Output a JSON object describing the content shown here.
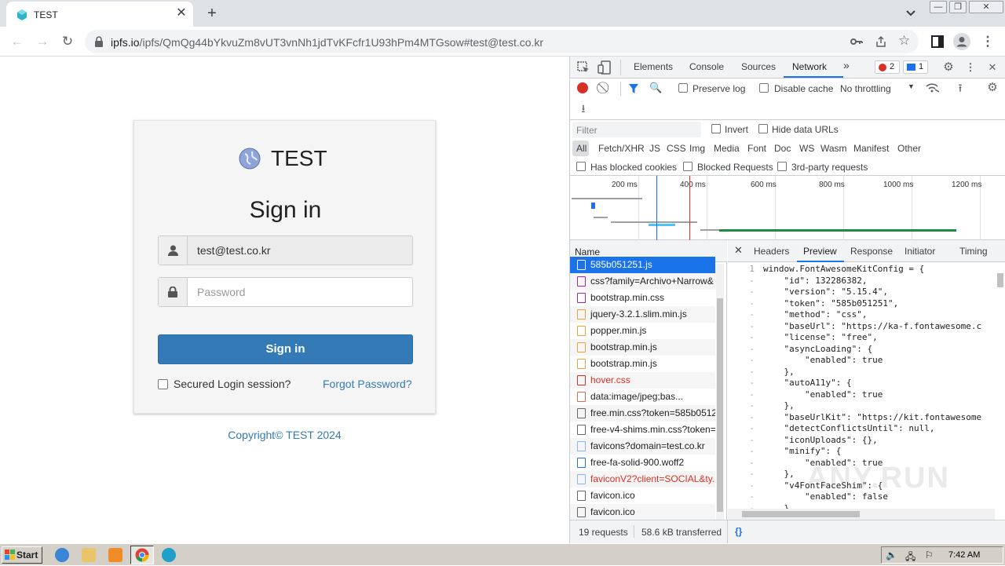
{
  "browser": {
    "tab_title": "TEST",
    "url_host": "ipfs.io",
    "url_rest": "/ipfs/QmQg44bYkvuZm8vUT3vnNh1jdTvKFcfr1U93hPm4MTGsow#test@test.co.kr"
  },
  "page": {
    "brand": "TEST",
    "heading": "Sign in",
    "email_value": "test@test.co.kr",
    "password_placeholder": "Password",
    "signin_label": "Sign in",
    "remember_label": "Secured Login session?",
    "forgot_label": "Forgot Password?",
    "copyright": "Copyright© TEST 2024"
  },
  "devtools": {
    "tabs": [
      "Elements",
      "Console",
      "Sources",
      "Network"
    ],
    "more": "»",
    "error_count": "2",
    "message_count": "1",
    "toolbar": {
      "preserve_log": "Preserve log",
      "disable_cache": "Disable cache",
      "throttling": "No throttling"
    },
    "filter_placeholder": "Filter",
    "invert": "Invert",
    "hide_data_urls": "Hide data URLs",
    "types": [
      "All",
      "Fetch/XHR",
      "JS",
      "CSS",
      "Img",
      "Media",
      "Font",
      "Doc",
      "WS",
      "Wasm",
      "Manifest",
      "Other"
    ],
    "has_blocked_cookies": "Has blocked cookies",
    "blocked_requests": "Blocked Requests",
    "third_party": "3rd-party requests",
    "timeline_ticks": [
      "200 ms",
      "400 ms",
      "600 ms",
      "800 ms",
      "1000 ms",
      "1200 ms"
    ],
    "name_header": "Name",
    "requests": [
      {
        "name": "585b051251.js",
        "color": "#ffffff",
        "icon": "#e8a33c",
        "selected": true
      },
      {
        "name": "css?family=Archivo+Narrow&",
        "color": "#202124",
        "icon": "#9c27b0"
      },
      {
        "name": "bootstrap.min.css",
        "color": "#202124",
        "icon": "#9c27b0"
      },
      {
        "name": "jquery-3.2.1.slim.min.js",
        "color": "#202124",
        "icon": "#e8a33c"
      },
      {
        "name": "popper.min.js",
        "color": "#202124",
        "icon": "#e8a33c"
      },
      {
        "name": "bootstrap.min.js",
        "color": "#202124",
        "icon": "#e8a33c"
      },
      {
        "name": "bootstrap.min.js",
        "color": "#202124",
        "icon": "#e8a33c"
      },
      {
        "name": "hover.css",
        "color": "#d93025",
        "icon": "#d93025"
      },
      {
        "name": "data:image/jpeg;bas...",
        "color": "#202124",
        "icon": "#e46a4b"
      },
      {
        "name": "free.min.css?token=585b0512",
        "color": "#202124",
        "icon": "#666666"
      },
      {
        "name": "free-v4-shims.min.css?token=",
        "color": "#202124",
        "icon": "#666666"
      },
      {
        "name": "favicons?domain=test.co.kr",
        "color": "#202124",
        "icon": "#8ab4f8"
      },
      {
        "name": "free-fa-solid-900.woff2",
        "color": "#202124",
        "icon": "#1a73e8"
      },
      {
        "name": "faviconV2?client=SOCIAL&ty...",
        "color": "#d93025",
        "icon": "#8ab4f8"
      },
      {
        "name": "favicon.ico",
        "color": "#202124",
        "icon": "#666666"
      },
      {
        "name": "favicon.ico",
        "color": "#202124",
        "icon": "#666666"
      }
    ],
    "detail_tabs": [
      "Headers",
      "Preview",
      "Response",
      "Initiator",
      "Timing"
    ],
    "active_detail_tab": "Preview",
    "code_lines": [
      {
        "ln": "1",
        "t": "window.FontAwesomeKitConfig = {"
      },
      {
        "ln": "-",
        "t": "    \"id\": 132286382,"
      },
      {
        "ln": "-",
        "t": "    \"version\": \"5.15.4\","
      },
      {
        "ln": "-",
        "t": "    \"token\": \"585b051251\","
      },
      {
        "ln": "-",
        "t": "    \"method\": \"css\","
      },
      {
        "ln": "-",
        "t": "    \"baseUrl\": \"https://ka-f.fontawesome.c"
      },
      {
        "ln": "-",
        "t": "    \"license\": \"free\","
      },
      {
        "ln": "-",
        "t": "    \"asyncLoading\": {"
      },
      {
        "ln": "-",
        "t": "        \"enabled\": true"
      },
      {
        "ln": "-",
        "t": "    },"
      },
      {
        "ln": "-",
        "t": "    \"autoA11y\": {"
      },
      {
        "ln": "-",
        "t": "        \"enabled\": true"
      },
      {
        "ln": "-",
        "t": "    },"
      },
      {
        "ln": "-",
        "t": "    \"baseUrlKit\": \"https://kit.fontawesome"
      },
      {
        "ln": "-",
        "t": "    \"detectConflictsUntil\": null,"
      },
      {
        "ln": "-",
        "t": "    \"iconUploads\": {},"
      },
      {
        "ln": "-",
        "t": "    \"minify\": {"
      },
      {
        "ln": "-",
        "t": "        \"enabled\": true"
      },
      {
        "ln": "-",
        "t": "    },"
      },
      {
        "ln": "-",
        "t": "    \"v4FontFaceShim\": {"
      },
      {
        "ln": "-",
        "t": "        \"enabled\": false"
      },
      {
        "ln": "-",
        "t": "    },"
      }
    ],
    "requests_count": "19 requests",
    "transferred": "58.6 kB transferred",
    "format_icon": "{}"
  },
  "taskbar": {
    "start_label": "Start",
    "clock": "7:42 AM"
  },
  "watermark": "ANY.RUN",
  "colors": {
    "accent": "#337ab7",
    "selected_row": "#1a73e8",
    "record_red": "#d93025"
  }
}
